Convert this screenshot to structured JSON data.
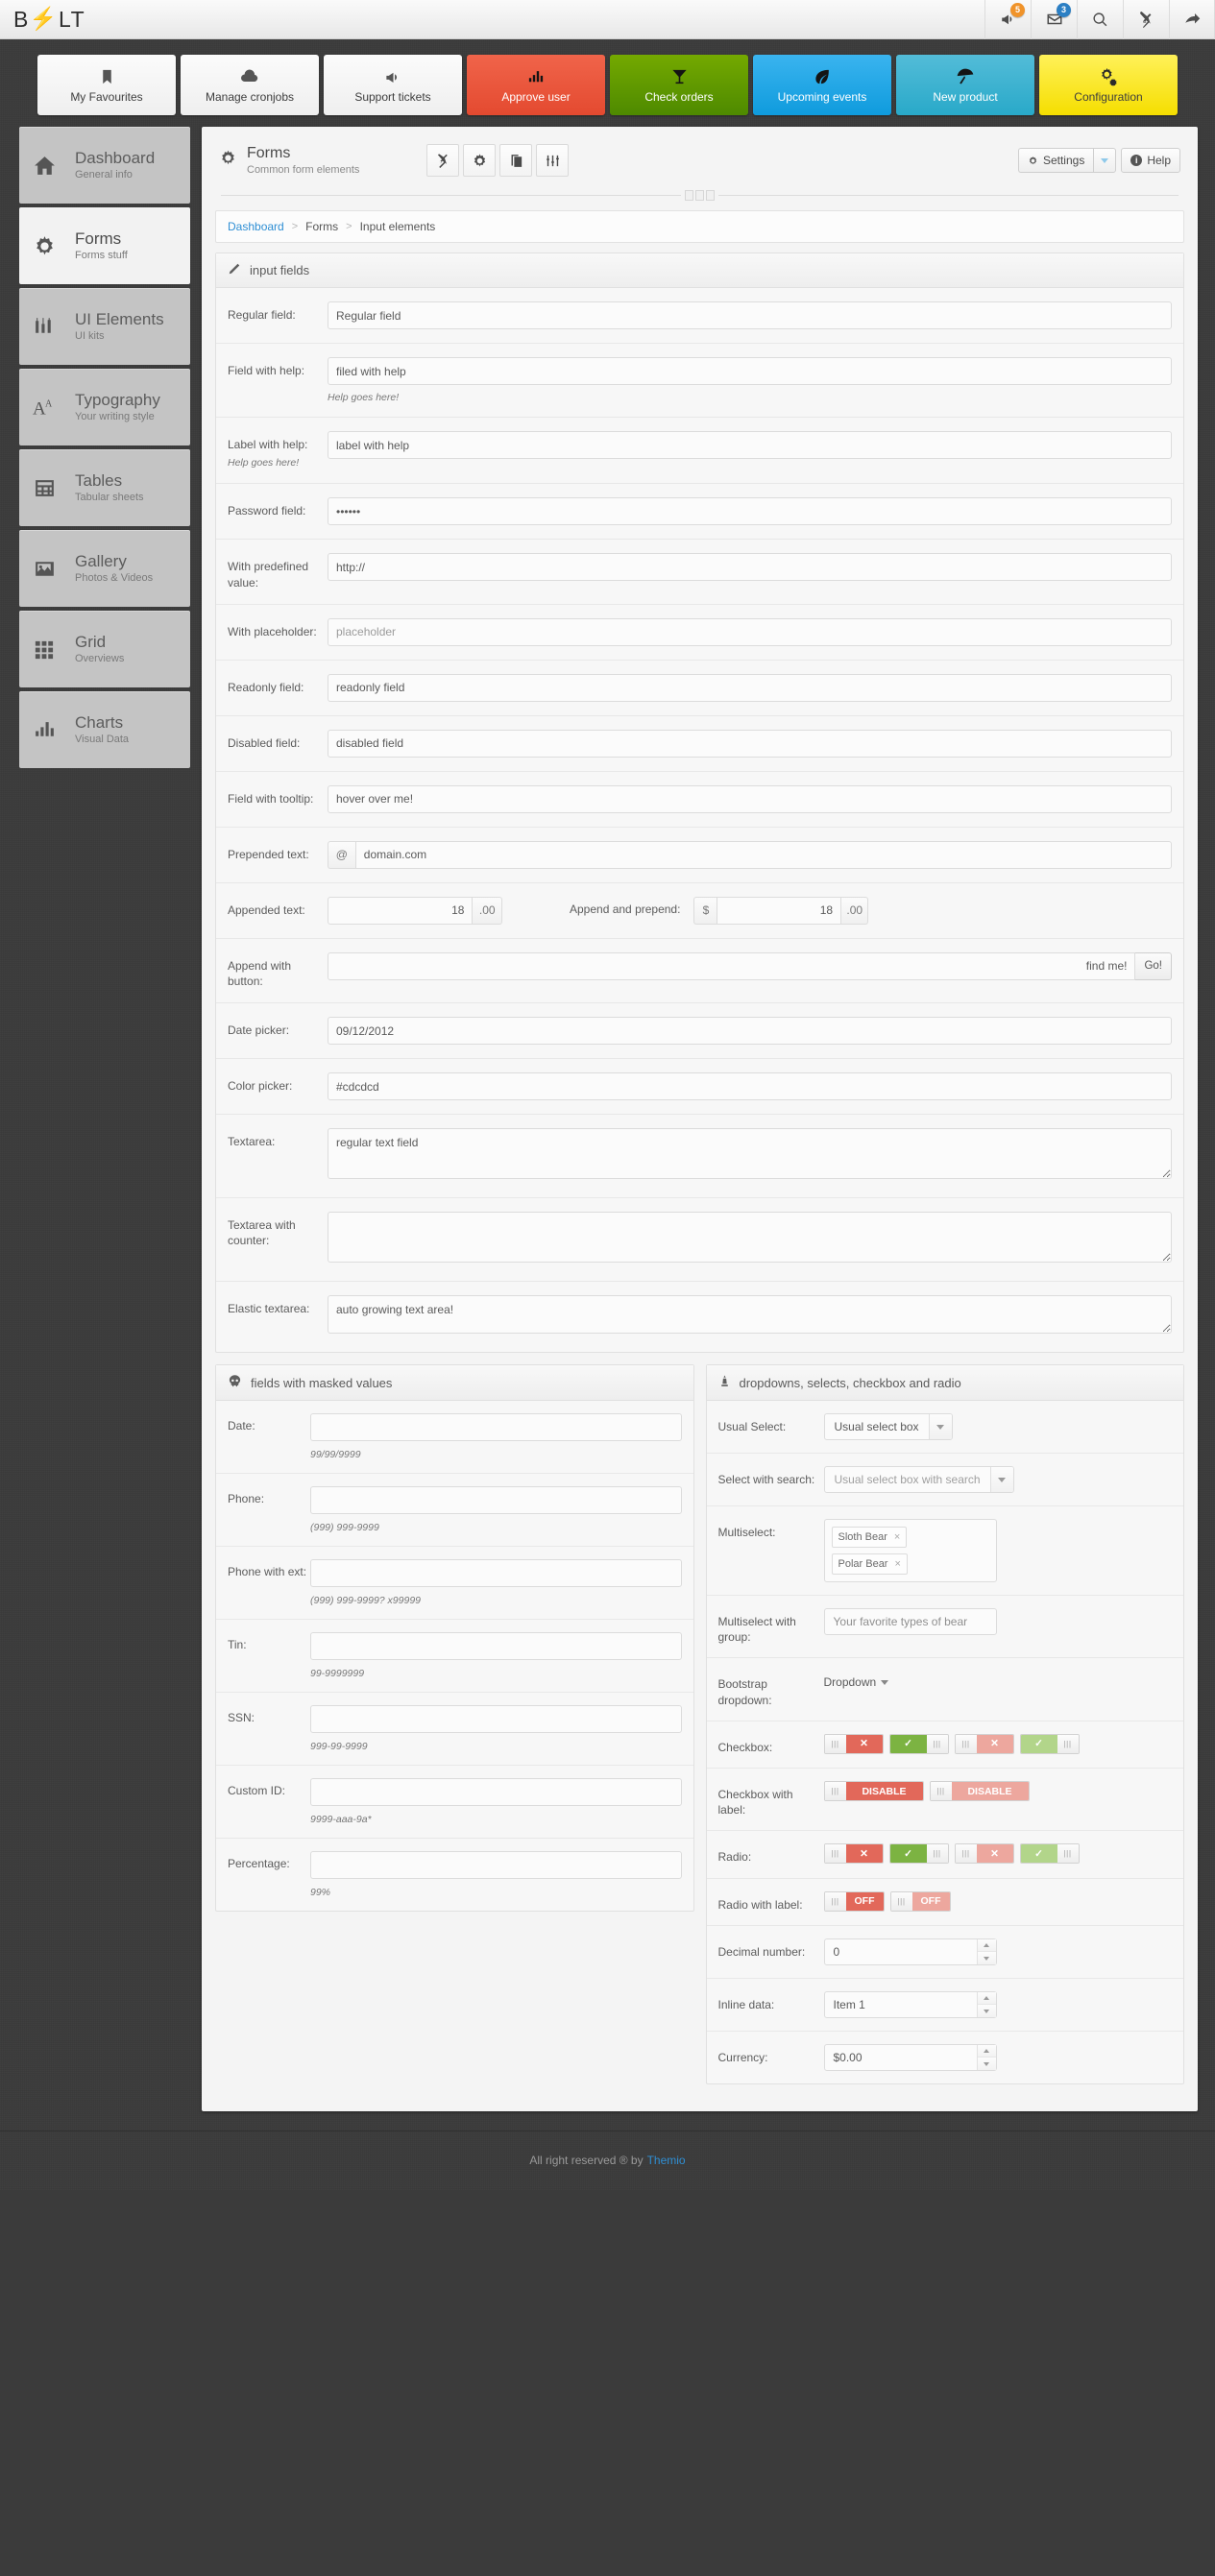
{
  "brand": {
    "text_left": "B",
    "text_right": "LT",
    "bolt": "⚡"
  },
  "header_icons": [
    {
      "name": "megaphone-icon",
      "badge": "5",
      "badge_color": "#f0932a"
    },
    {
      "name": "envelope-icon",
      "badge": "3",
      "badge_color": "#2b7fc4"
    },
    {
      "name": "search-icon",
      "badge": ""
    },
    {
      "name": "tools-icon",
      "badge": ""
    },
    {
      "name": "share-arrow-icon",
      "badge": ""
    }
  ],
  "tiles": [
    {
      "label": "My Favourites",
      "icon": "bookmark-icon",
      "style": "t-default"
    },
    {
      "label": "Manage cronjobs",
      "icon": "cloud-icon",
      "style": "t-default"
    },
    {
      "label": "Support tickets",
      "icon": "megaphone-icon",
      "style": "t-default"
    },
    {
      "label": "Approve user",
      "icon": "bar-chart-icon",
      "style": "t-red"
    },
    {
      "label": "Check orders",
      "icon": "cocktail-icon",
      "style": "t-green"
    },
    {
      "label": "Upcoming events",
      "icon": "leaf-icon",
      "style": "t-blue"
    },
    {
      "label": "New product",
      "icon": "umbrella-icon",
      "style": "t-teal"
    },
    {
      "label": "Configuration",
      "icon": "gears-icon",
      "style": "t-yellow"
    }
  ],
  "sidebar": {
    "items": [
      {
        "title": "Dashboard",
        "sub": "General info",
        "icon": "home-icon",
        "active": false
      },
      {
        "title": "Forms",
        "sub": "Forms stuff",
        "icon": "gear-icon",
        "active": true
      },
      {
        "title": "UI Elements",
        "sub": "UI kits",
        "icon": "sliders-icon",
        "active": false
      },
      {
        "title": "Typography",
        "sub": "Your writing style",
        "icon": "typography-icon",
        "active": false
      },
      {
        "title": "Tables",
        "sub": "Tabular sheets",
        "icon": "table-icon",
        "active": false
      },
      {
        "title": "Gallery",
        "sub": "Photos & Videos",
        "icon": "image-icon",
        "active": false
      },
      {
        "title": "Grid",
        "sub": "Overviews",
        "icon": "grid-icon",
        "active": false
      },
      {
        "title": "Charts",
        "sub": "Visual Data",
        "icon": "bar-chart-icon",
        "active": false
      }
    ]
  },
  "page": {
    "title": "Forms",
    "subtitle": "Common form elements",
    "icon": "gear-icon",
    "tools": [
      "tools-icon",
      "gear-icon",
      "copy-icon",
      "sliders-icon"
    ],
    "settings_label": "Settings",
    "help_label": "Help",
    "breadcrumb": {
      "root": "Dashboard",
      "mid": "Forms",
      "current": "Input elements",
      "sep": ">"
    }
  },
  "input_fields_panel": {
    "title": "input fields",
    "icon": "pencil-icon",
    "rows": [
      {
        "label": "Regular field:",
        "value": "Regular field",
        "type": "text"
      },
      {
        "label": "Field with help:",
        "value": "filed with help",
        "type": "text",
        "help": "Help goes here!"
      },
      {
        "label": "Label with help:",
        "label_help": "Help goes here!",
        "value": "label with help",
        "type": "text"
      },
      {
        "label": "Password field:",
        "value": "••••••",
        "type": "password"
      },
      {
        "label": "With predefined value:",
        "value": "http://",
        "type": "text"
      },
      {
        "label": "With placeholder:",
        "value": "",
        "placeholder": "placeholder",
        "type": "text"
      },
      {
        "label": "Readonly field:",
        "value": "readonly field",
        "type": "text"
      },
      {
        "label": "Disabled field:",
        "value": "disabled field",
        "type": "text"
      },
      {
        "label": "Field with tooltip:",
        "value": "hover over me!",
        "type": "text"
      }
    ],
    "prepended": {
      "label": "Prepended text:",
      "addon": "@",
      "value": "domain.com"
    },
    "appended": {
      "label": "Appended text:",
      "value": "18",
      "addon": ".00"
    },
    "append_prepend": {
      "label": "Append and prepend:",
      "pre": "$",
      "value": "18",
      "post": ".00"
    },
    "append_button": {
      "label": "Append with button:",
      "value": "find me!",
      "button": "Go!"
    },
    "date_picker": {
      "label": "Date picker:",
      "value": "09/12/2012"
    },
    "color_picker": {
      "label": "Color picker:",
      "value": "#cdcdcd"
    },
    "textarea": {
      "label": "Textarea:",
      "value": "regular text field"
    },
    "textarea_counter": {
      "label": "Textarea with counter:",
      "value": ""
    },
    "elastic_textarea": {
      "label": "Elastic textarea:",
      "value": "auto growing text area!"
    }
  },
  "masked_panel": {
    "title": "fields with masked values",
    "icon": "skull-icon",
    "rows": [
      {
        "label": "Date:",
        "value": "",
        "mask": "99/99/9999"
      },
      {
        "label": "Phone:",
        "value": "",
        "mask": "(999) 999-9999"
      },
      {
        "label": "Phone with ext:",
        "value": "",
        "mask": "(999) 999-9999? x99999"
      },
      {
        "label": "Tin:",
        "value": "",
        "mask": "99-9999999"
      },
      {
        "label": "SSN:",
        "value": "",
        "mask": "999-99-9999"
      },
      {
        "label": "Custom ID:",
        "value": "",
        "mask": "9999-aaa-9a*"
      },
      {
        "label": "Percentage:",
        "value": "",
        "mask": "99%"
      }
    ]
  },
  "dropdown_panel": {
    "title": "dropdowns, selects, checkbox and radio",
    "icon": "lighthouse-icon",
    "usual_select": {
      "label": "Usual Select:",
      "value": "Usual select box"
    },
    "select_search": {
      "label": "Select with search:",
      "value": "Usual select box with search"
    },
    "multiselect": {
      "label": "Multiselect:",
      "tags": [
        "Sloth Bear",
        "Polar Bear"
      ],
      "remove": "×"
    },
    "multiselect_group": {
      "label": "Multiselect with group:",
      "placeholder": "Your favorite types of bear"
    },
    "bootstrap_dropdown": {
      "label": "Bootstrap dropdown:",
      "value": "Dropdown"
    },
    "checkbox": {
      "label": "Checkbox:",
      "toggles": [
        {
          "state": "off",
          "style": "red",
          "glyph": "✕"
        },
        {
          "state": "on",
          "style": "green",
          "glyph": "✓"
        },
        {
          "state": "off",
          "style": "red-l",
          "glyph": "✕"
        },
        {
          "state": "on",
          "style": "green-l",
          "glyph": "✓"
        }
      ]
    },
    "checkbox_label": {
      "label": "Checkbox with label:",
      "toggles": [
        {
          "state": "off",
          "style": "red",
          "glyph": "DISABLE"
        },
        {
          "state": "off",
          "style": "red-l",
          "glyph": "DISABLE"
        }
      ]
    },
    "radio": {
      "label": "Radio:",
      "toggles": [
        {
          "state": "off",
          "style": "red",
          "glyph": "✕"
        },
        {
          "state": "on",
          "style": "green",
          "glyph": "✓"
        },
        {
          "state": "off",
          "style": "red-l",
          "glyph": "✕"
        },
        {
          "state": "on",
          "style": "green-l",
          "glyph": "✓"
        }
      ]
    },
    "radio_label": {
      "label": "Radio with label:",
      "toggles": [
        {
          "state": "off",
          "style": "red",
          "glyph": "OFF"
        },
        {
          "state": "off",
          "style": "red-l",
          "glyph": "OFF"
        }
      ]
    },
    "decimal": {
      "label": "Decimal number:",
      "value": "0"
    },
    "inline": {
      "label": "Inline data:",
      "value": "Item 1"
    },
    "currency": {
      "label": "Currency:",
      "value": "$0.00"
    }
  },
  "footer": {
    "text": "All right reserved ® by",
    "link": "Themio"
  }
}
